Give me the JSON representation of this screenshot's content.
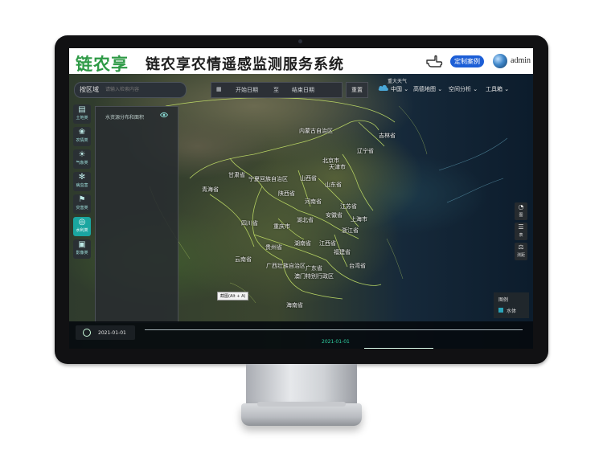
{
  "header": {
    "logo": "链农享",
    "title": "链农享农情遥感监测服务系统",
    "case_button": "定制案例",
    "username": "admin"
  },
  "search": {
    "region_select": "按区域",
    "placeholder": "请输入检索内容"
  },
  "date_range": {
    "start": "开始日期",
    "separator": "至",
    "end": "结束日期"
  },
  "reset_button": "重置",
  "weather_top": "重大天气",
  "menus": {
    "region": "中国",
    "basemap": "高德地图",
    "spatial": "空间分析",
    "tools": "工具箱"
  },
  "toolbar": [
    {
      "label": "土地类",
      "icon": "land-icon"
    },
    {
      "label": "农情类",
      "icon": "crop-icon"
    },
    {
      "label": "气象类",
      "icon": "weather-icon"
    },
    {
      "label": "病虫害",
      "icon": "pest-icon"
    },
    {
      "label": "灾害类",
      "icon": "disaster-icon"
    },
    {
      "label": "水利类",
      "icon": "water-icon"
    },
    {
      "label": "影像类",
      "icon": "image-icon"
    }
  ],
  "panel": {
    "item": "水资源分布和面积"
  },
  "provinces": [
    {
      "name": "内蒙古自治区"
    },
    {
      "name": "吉林省"
    },
    {
      "name": "辽宁省"
    },
    {
      "name": "北京市"
    },
    {
      "name": "天津市"
    },
    {
      "name": "甘肃省"
    },
    {
      "name": "宁夏回族自治区"
    },
    {
      "name": "山西省"
    },
    {
      "name": "山东省"
    },
    {
      "name": "青海省"
    },
    {
      "name": "陕西省"
    },
    {
      "name": "河南省"
    },
    {
      "name": "江苏省"
    },
    {
      "name": "安徽省"
    },
    {
      "name": "湖北省"
    },
    {
      "name": "上海市"
    },
    {
      "name": "四川省"
    },
    {
      "name": "重庆市"
    },
    {
      "name": "浙江省"
    },
    {
      "name": "湖南省"
    },
    {
      "name": "江西省"
    },
    {
      "name": "贵州省"
    },
    {
      "name": "福建省"
    },
    {
      "name": "云南省"
    },
    {
      "name": "广西壮族自治区"
    },
    {
      "name": "广东省"
    },
    {
      "name": "台湾省"
    },
    {
      "name": "澳门特别行政区"
    },
    {
      "name": "海南省"
    }
  ],
  "right_tools": [
    {
      "label": "图",
      "icon": "pie-icon"
    },
    {
      "label": "表",
      "icon": "list-icon"
    },
    {
      "label": "测距",
      "icon": "measure-icon"
    }
  ],
  "legend": {
    "title": "图例",
    "item": "水体",
    "color": "#2aa3b8"
  },
  "timeline": {
    "date": "2021-01-01",
    "current": "2021-01-01",
    "tooltip": "截图(Alt + A)"
  }
}
